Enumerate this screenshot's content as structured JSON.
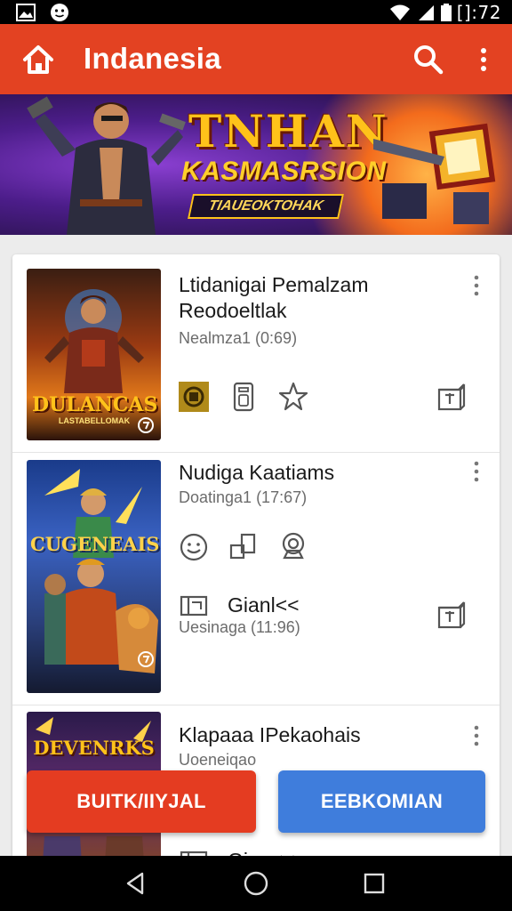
{
  "status_bar": {
    "time": "[]:72",
    "icons": [
      "image-icon",
      "face-icon",
      "wifi-icon",
      "signal-icon",
      "battery-icon"
    ]
  },
  "app_bar": {
    "title": "Indanesia",
    "icons": [
      "home-icon",
      "search-icon",
      "more-vert-icon"
    ],
    "color": "#e34222"
  },
  "banner": {
    "headline": "TNHAN",
    "subheadline": "KASMASRSION",
    "ribbon": "TIAUEOKTOHAK"
  },
  "games": [
    {
      "name": "Ltidanigai Pemalzam Reodoeltlak",
      "meta": "Nealmza1 (0:69)",
      "art_label": "DULANCAS",
      "art_sub": "LASTABELLOMAK",
      "actions": [
        "coin-icon",
        "phone-icon",
        "star-icon",
        "share-box-icon"
      ]
    },
    {
      "name": "Nudiga Kaatiams",
      "meta": "Doatinga1 (17:67)",
      "art_label": "CUGENEAIS",
      "actions": [
        "smile-icon",
        "squares-icon",
        "badge-icon"
      ],
      "extra": {
        "label": "Gianl<<",
        "meta": "Uesinaga (11:96)",
        "icons": [
          "frame-icon",
          "share-box-icon"
        ]
      }
    },
    {
      "name": "Klapaaa IPekaohais",
      "meta": "Uoeneiqao",
      "art_label": "DEVENRKS",
      "partial_label": "Gian<<",
      "icons": [
        "frame-icon"
      ]
    }
  ],
  "buttons": {
    "primary": "BUITK/IIYJAL",
    "secondary": "EEBKOMIAN"
  },
  "nav": [
    "back-icon",
    "home-circle-icon",
    "recents-icon"
  ]
}
